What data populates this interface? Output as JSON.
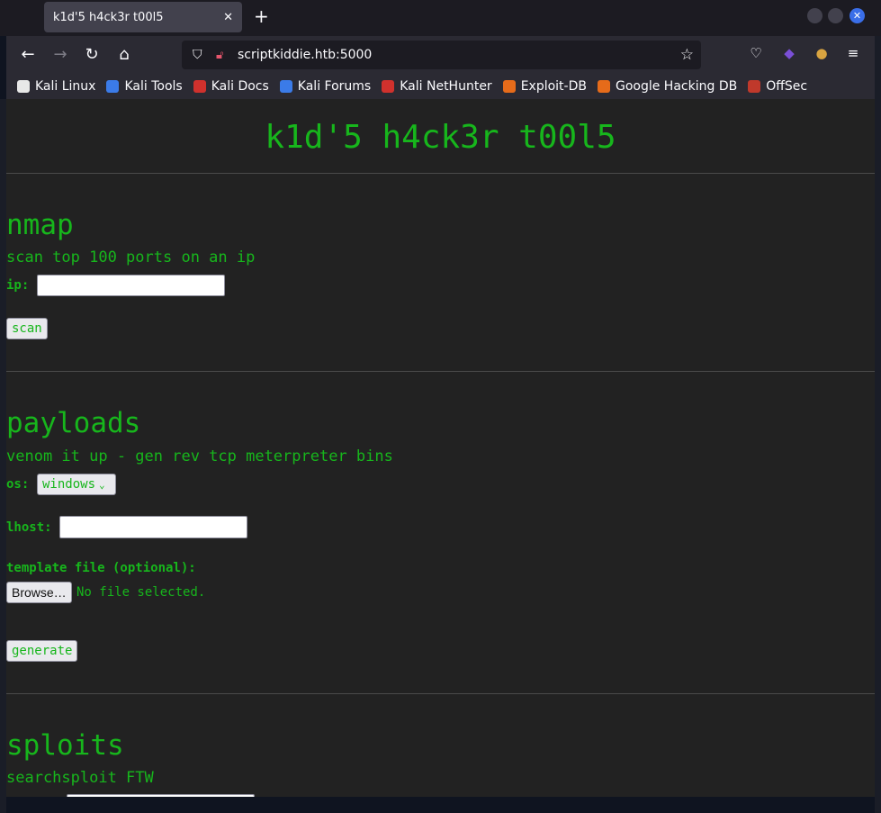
{
  "browser": {
    "tab_title": "k1d'5 h4ck3r t00l5",
    "tab_close": "✕",
    "new_tab": "+",
    "url": "scriptkiddie.htb:5000",
    "bookmarks": [
      {
        "label": "Kali Linux",
        "icon_color": "#e8e8e8"
      },
      {
        "label": "Kali Tools",
        "icon_color": "#3b7be8"
      },
      {
        "label": "Kali Docs",
        "icon_color": "#d0312d"
      },
      {
        "label": "Kali Forums",
        "icon_color": "#3b7be8"
      },
      {
        "label": "Kali NetHunter",
        "icon_color": "#d0312d"
      },
      {
        "label": "Exploit-DB",
        "icon_color": "#e66b1a"
      },
      {
        "label": "Google Hacking DB",
        "icon_color": "#e66b1a"
      },
      {
        "label": "OffSec",
        "icon_color": "#c0392b"
      }
    ]
  },
  "page": {
    "title": "k1d'5 h4ck3r t00l5",
    "nmap": {
      "title": "nmap",
      "subtitle": "scan top 100 ports on an ip",
      "ip_label": "ip:",
      "ip_value": "",
      "scan_button": "scan"
    },
    "payloads": {
      "title": "payloads",
      "subtitle": "venom it up - gen rev tcp meterpreter bins",
      "os_label": "os:",
      "os_selected": "windows",
      "lhost_label": "lhost:",
      "lhost_value": "",
      "template_label": "template file (optional):",
      "browse_button": "Browse…",
      "no_file_text": "No file selected.",
      "generate_button": "generate"
    },
    "sploits": {
      "title": "sploits",
      "subtitle": "searchsploit FTW"
    }
  },
  "colors": {
    "accent_green": "#17b61c",
    "page_background": "#222222"
  }
}
